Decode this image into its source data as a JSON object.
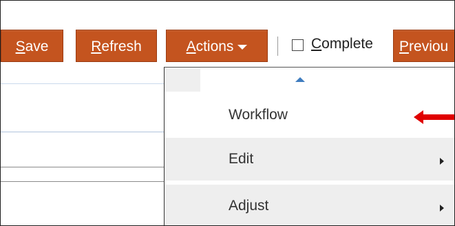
{
  "toolbar": {
    "save": {
      "accesskey": "S",
      "rest": "ave"
    },
    "refresh": {
      "accesskey": "R",
      "rest": "efresh"
    },
    "actions": {
      "accesskey": "A",
      "rest": "ctions"
    },
    "complete": {
      "accesskey": "C",
      "rest": "omplete",
      "checked": false
    },
    "previous": {
      "accesskey": "P",
      "rest": "reviou"
    }
  },
  "actions_menu": {
    "items": [
      {
        "label": "Workflow",
        "has_submenu": false,
        "highlighted": true
      },
      {
        "label": "Edit",
        "has_submenu": true
      },
      {
        "label": "Adjust",
        "has_submenu": true
      }
    ]
  },
  "colors": {
    "button_bg": "#c4541f",
    "annotation_arrow": "#e00000",
    "menu_item_bg": "#eeeeee"
  }
}
